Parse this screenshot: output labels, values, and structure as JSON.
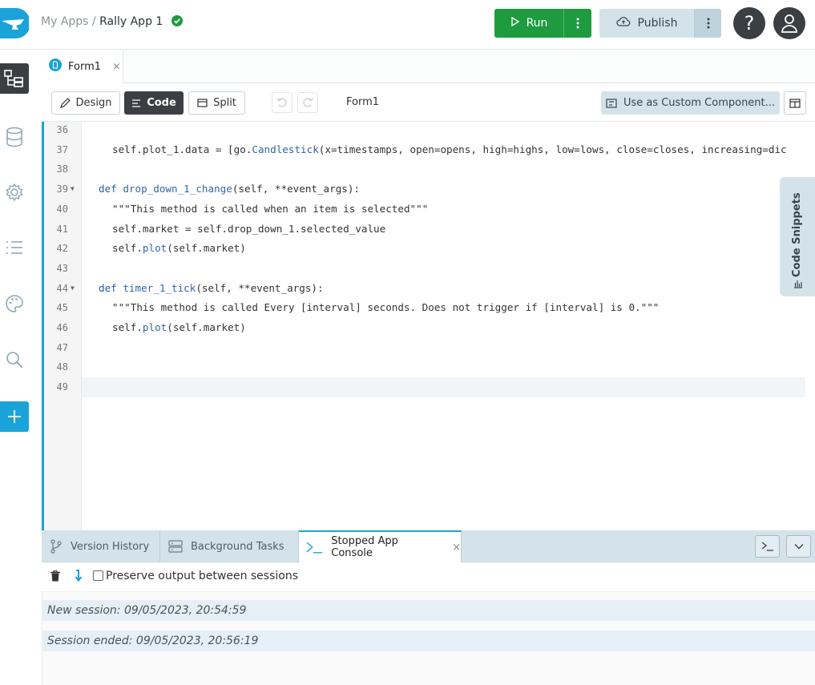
{
  "header": {
    "breadcrumb_root": "My Apps",
    "breadcrumb_sep": "/",
    "app_name": "Rally App 1",
    "run_label": "Run",
    "publish_label": "Publish",
    "help_glyph": "?"
  },
  "icons": {
    "logo": "anvil-logo",
    "status": "check-circle-icon",
    "run": "play-icon",
    "publish": "cloud-upload-icon"
  },
  "editor_tabs": [
    {
      "label": "Form1",
      "close": "×"
    }
  ],
  "toolbar": {
    "design_label": "Design",
    "code_label": "Code",
    "split_label": "Split",
    "form_title": "Form1",
    "custom_label": "Use as Custom Component..."
  },
  "code": {
    "lines": [
      {
        "n": "36",
        "text": ""
      },
      {
        "n": "37",
        "text": "self.plot_1.data = [go.Candlestick(x=timestamps, open=opens, high=highs, low=lows, close=closes, increasing=dic"
      },
      {
        "n": "38",
        "text": ""
      },
      {
        "n": "39",
        "text": "def drop_down_1_change(self, **event_args):"
      },
      {
        "n": "40",
        "text": "\"\"\"This method is called when an item is selected\"\"\""
      },
      {
        "n": "41",
        "text": "self.market = self.drop_down_1.selected_value"
      },
      {
        "n": "42",
        "text": "self.plot(self.market)"
      },
      {
        "n": "43",
        "text": ""
      },
      {
        "n": "44",
        "text": "def timer_1_tick(self, **event_args):"
      },
      {
        "n": "45",
        "text": "\"\"\"This method is called Every [interval] seconds. Does not trigger if [interval] is 0.\"\"\""
      },
      {
        "n": "46",
        "text": "self.plot(self.market)"
      },
      {
        "n": "47",
        "text": ""
      },
      {
        "n": "48",
        "text": ""
      },
      {
        "n": "49",
        "text": ""
      }
    ]
  },
  "snippets_label": "Code Snippets",
  "panel": {
    "tabs": [
      {
        "label": "Version History"
      },
      {
        "label": "Background Tasks"
      },
      {
        "label": "Stopped App Console",
        "close": "×"
      }
    ],
    "preserve_label": "Preserve output between sessions",
    "console": [
      "New session: 09/05/2023, 20:54:59",
      "Session ended: 09/05/2023, 20:56:19"
    ]
  },
  "colors": {
    "accent": "#1aa3d8",
    "run_green": "#1e9b3f",
    "dark": "#3b3e42",
    "panel_blue": "#d4e3ea"
  }
}
